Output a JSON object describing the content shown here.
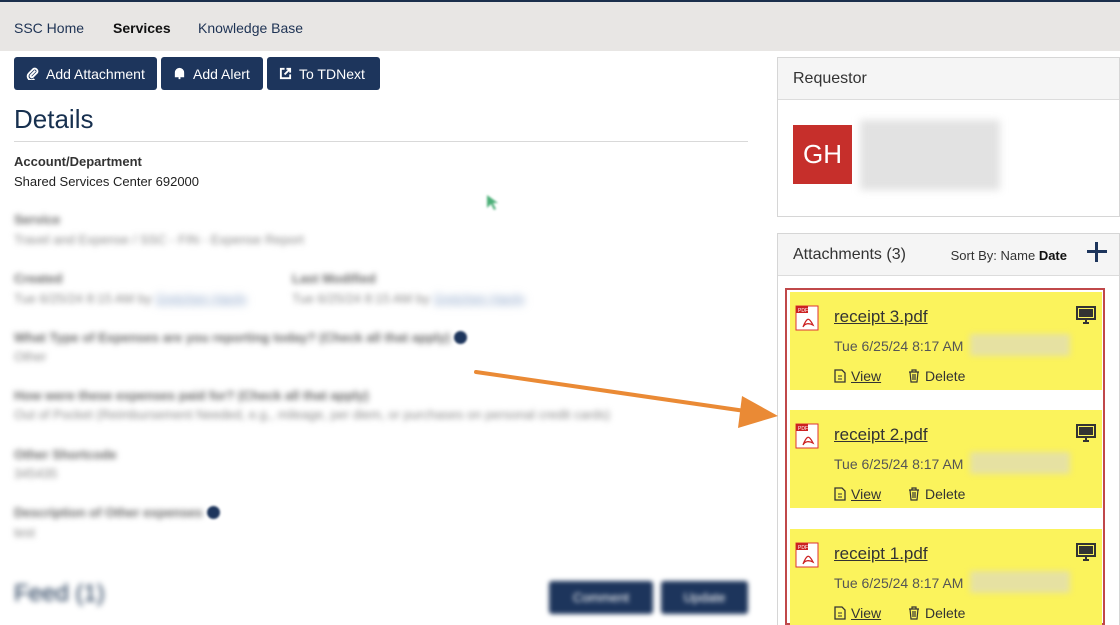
{
  "nav": {
    "items": [
      {
        "label": "SSC Home",
        "active": false
      },
      {
        "label": "Services",
        "active": true
      },
      {
        "label": "Knowledge Base",
        "active": false
      }
    ]
  },
  "toolbar": {
    "add_attachment": "Add Attachment",
    "add_alert": "Add Alert",
    "to_tdnext": "To TDNext"
  },
  "details": {
    "title": "Details",
    "account_label": "Account/Department",
    "account_value": "Shared Services Center 692000",
    "service_label": "Service",
    "service_value": "Travel and Expense / SSC - FIN - Expense Report",
    "created_label": "Created",
    "created_value": "Tue 6/25/24 8:15 AM by",
    "created_by": "Gretchen Hardy",
    "modified_label": "Last Modified",
    "modified_value": "Tue 6/25/24 8:15 AM by",
    "modified_by": "Gretchen Hardy",
    "q1_label": "What Type of Expenses are you reporting today? (Check all that apply)",
    "q1_value": "Other",
    "q2_label": "How were these expenses paid for? (Check all that apply)",
    "q2_value": "Out of Pocket (Reimbursement Needed, e.g., mileage, per diem, or purchases on personal credit cards)",
    "q3_label": "Other Shortcode",
    "q3_value": "345435",
    "q4_label": "Description of Other expenses",
    "q4_value": "test"
  },
  "feed": {
    "title": "Feed (1)",
    "comment": "Comment",
    "update": "Update"
  },
  "requestor": {
    "title": "Requestor",
    "initials": "GH",
    "avatar_color": "#c62f2b"
  },
  "attachments": {
    "title": "Attachments (3)",
    "sort_by": "Sort By:",
    "sort_name": "Name",
    "sort_date": "Date",
    "items": [
      {
        "name": "receipt 3.pdf",
        "date": "Tue 6/25/24 8:17 AM",
        "view": "View",
        "delete": "Delete"
      },
      {
        "name": "receipt 2.pdf",
        "date": "Tue 6/25/24 8:17 AM",
        "view": "View",
        "delete": "Delete"
      },
      {
        "name": "receipt 1.pdf",
        "date": "Tue 6/25/24 8:17 AM",
        "view": "View",
        "delete": "Delete"
      }
    ]
  },
  "colors": {
    "nav_dark": "#1d355c",
    "highlight": "#fbf35c",
    "frame": "#c0484a",
    "arrow": "#ea8a35"
  }
}
